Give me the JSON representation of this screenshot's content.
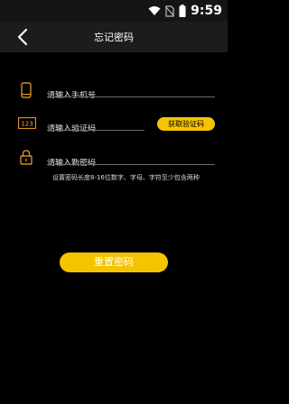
{
  "status_bar": {
    "time": "9:59"
  },
  "header": {
    "title": "忘记密码"
  },
  "form": {
    "phone": {
      "placeholder": "请输入手机号",
      "value": ""
    },
    "code": {
      "placeholder": "请输入验证码",
      "value": "",
      "icon_text": "123",
      "get_code_label": "获取验证码"
    },
    "new_password": {
      "placeholder": "请输入新密码",
      "value": ""
    },
    "hint": "设置密码长度8-16位数字、字母、字符至少包含两种"
  },
  "actions": {
    "reset_label": "重置密码"
  },
  "colors": {
    "accent": "#f5c400",
    "background": "#000000"
  }
}
